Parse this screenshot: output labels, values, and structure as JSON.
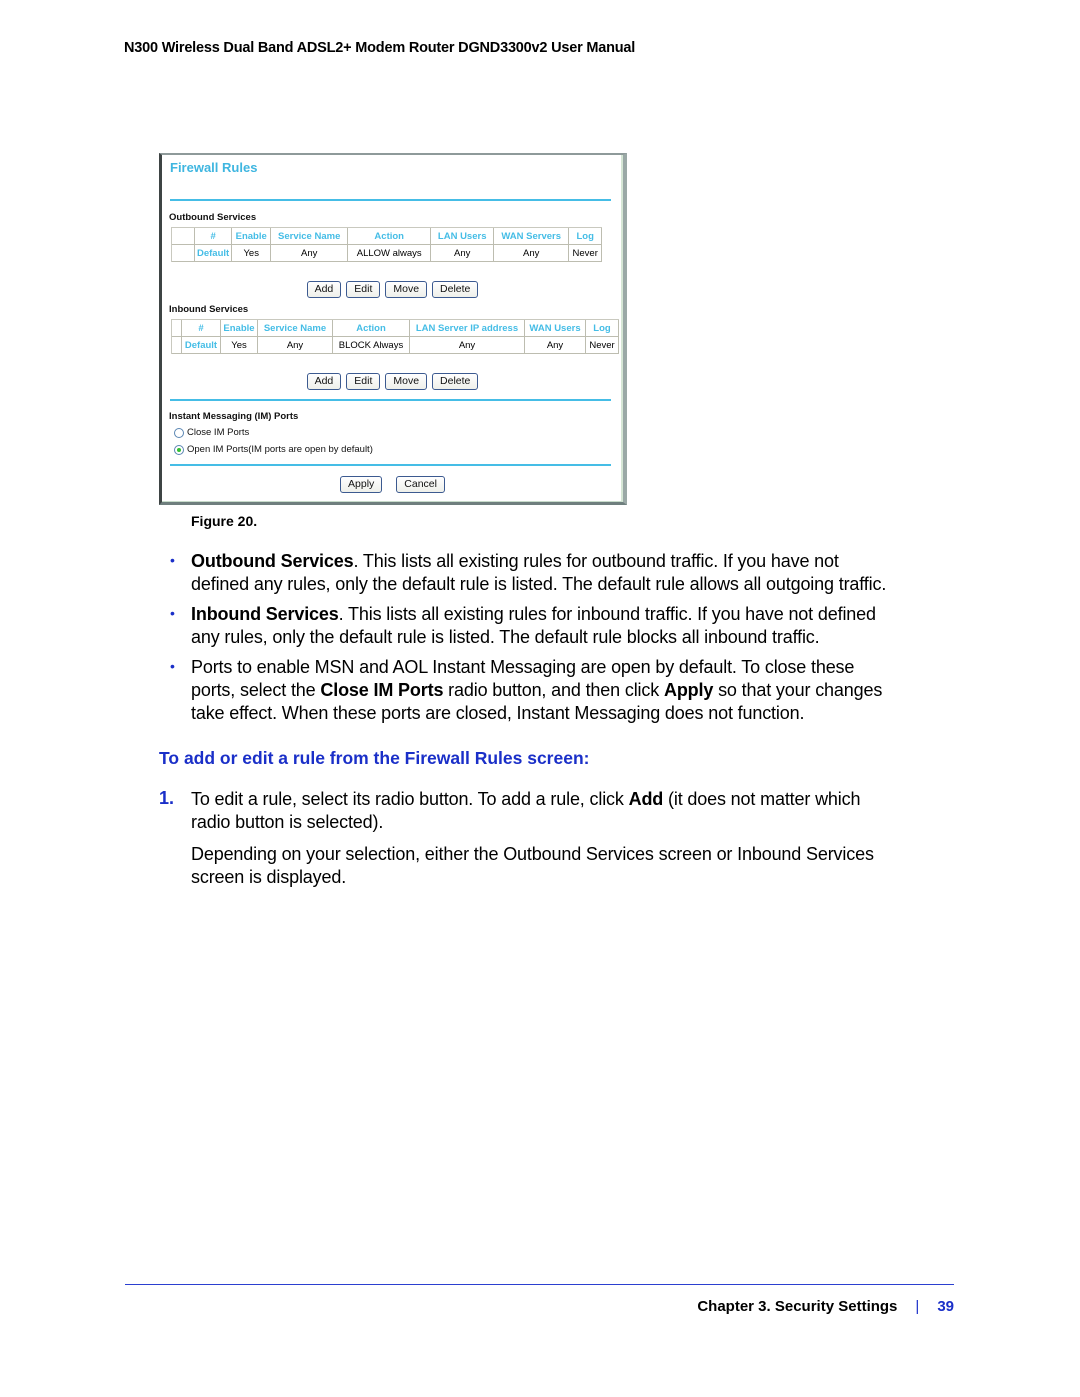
{
  "running_header": "N300 Wireless Dual Band ADSL2+ Modem Router DGND3300v2 User Manual",
  "figure": {
    "title": "Firewall Rules",
    "outbound": {
      "section_label": "Outbound Services",
      "headers": [
        "",
        "#",
        "Enable",
        "Service Name",
        "Action",
        "LAN Users",
        "WAN Servers",
        "Log"
      ],
      "rows": [
        [
          "",
          "Default",
          "Yes",
          "Any",
          "ALLOW always",
          "Any",
          "Any",
          "Never"
        ]
      ],
      "buttons": [
        "Add",
        "Edit",
        "Move",
        "Delete"
      ]
    },
    "inbound": {
      "section_label": "Inbound Services",
      "headers": [
        "",
        "#",
        "Enable",
        "Service Name",
        "Action",
        "LAN Server IP address",
        "WAN Users",
        "Log"
      ],
      "rows": [
        [
          "",
          "Default",
          "Yes",
          "Any",
          "BLOCK Always",
          "Any",
          "Any",
          "Never"
        ]
      ],
      "buttons": [
        "Add",
        "Edit",
        "Move",
        "Delete"
      ]
    },
    "im": {
      "section_label": "Instant Messaging (IM) Ports",
      "options": [
        {
          "label": "Close IM Ports",
          "selected": false
        },
        {
          "label": "Open IM Ports(IM ports are open by default)",
          "selected": true
        }
      ]
    },
    "actions": {
      "apply": "Apply",
      "cancel": "Cancel"
    },
    "caption": "Figure 20."
  },
  "bullets": [
    {
      "bold": "Outbound Services",
      "rest_line1": ". This lists all existing rules for outbound traffic. If you have not",
      "line2": "defined any rules, only the default rule is listed. The default rule allows all outgoing traffic."
    },
    {
      "bold": "Inbound Services",
      "rest_line1": ". This lists all existing rules for inbound traffic. If you have not defined",
      "line2": "any rules, only the default rule is listed. The default rule blocks all inbound traffic."
    },
    {
      "line1": "Ports to enable MSN and AOL Instant Messaging are open by default. To close these",
      "line2_a": "ports, select the ",
      "line2_bold1": "Close IM Ports",
      "line2_b": " radio button, and then click ",
      "line2_bold2": "Apply",
      "line2_c": " so that your changes",
      "line3": "take effect. When these ports are closed, Instant Messaging does not function."
    }
  ],
  "procedure": {
    "heading": "To add or edit a rule from the Firewall Rules screen:",
    "steps": [
      {
        "num": "1.",
        "line1_a": "To edit a rule, select its radio button. To add a rule, click ",
        "line1_bold": "Add",
        "line1_b": " (it does not matter which",
        "line2": "radio button is selected).",
        "followup_line1": "Depending on your selection, either the Outbound Services screen or Inbound Services",
        "followup_line2": "screen is displayed."
      }
    ]
  },
  "footer": {
    "chapter": "Chapter 3.  Security Settings",
    "separator": "|",
    "page": "39"
  },
  "colors": {
    "accent_blue": "#1a2fc8",
    "ui_cyan": "#45bde6"
  }
}
